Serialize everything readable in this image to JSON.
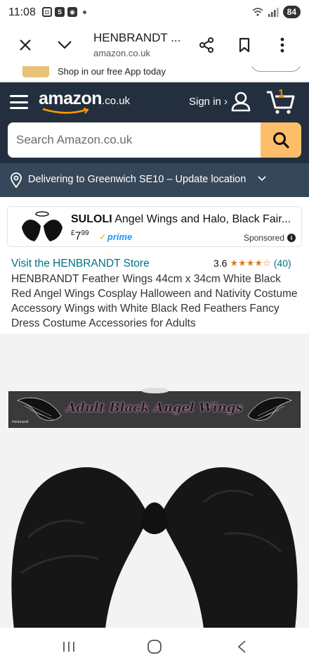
{
  "status_bar": {
    "time": "11:08",
    "battery": "84",
    "icons": [
      "screenshot-icon",
      "s-app-icon",
      "vpn-icon",
      "dot-icon",
      "wifi-icon",
      "signal-icon"
    ]
  },
  "browser": {
    "title": "HENBRANDT ...",
    "url": "amazon.co.uk"
  },
  "app_banner": {
    "text": "Shop in our free App today"
  },
  "header": {
    "logo_word": "amazon",
    "logo_suffix": ".co.uk",
    "sign_in": "Sign in ›",
    "cart_count": "1",
    "brand_color": "#232f3e",
    "accent_color": "#febd69"
  },
  "search": {
    "placeholder": "Search Amazon.co.uk",
    "value": ""
  },
  "delivery": {
    "text": "Delivering to Greenwich SE10 – Update location"
  },
  "sponsored": {
    "brand": "SULOLI",
    "title": "Angel Wings and Halo, Black Fair...",
    "price_symbol": "£",
    "price_whole": "7",
    "price_fraction": "99",
    "prime": "prime",
    "label": "Sponsored"
  },
  "product": {
    "store_link": "Visit the HENBRANDT Store",
    "rating": "3.6",
    "stars": "★★★★☆",
    "review_count": "(40)",
    "title": "HENBRANDT Feather Wings 44cm x 34cm White Black Red Angel Wings Cosplay Halloween and Nativity Costume Accessory Wings with White Black Red Feathers Fancy Dress Costume Accessories for Adults"
  },
  "image": {
    "banner_text": "Adult Black Angel Wings",
    "banner_tag": "Henbrandt"
  }
}
